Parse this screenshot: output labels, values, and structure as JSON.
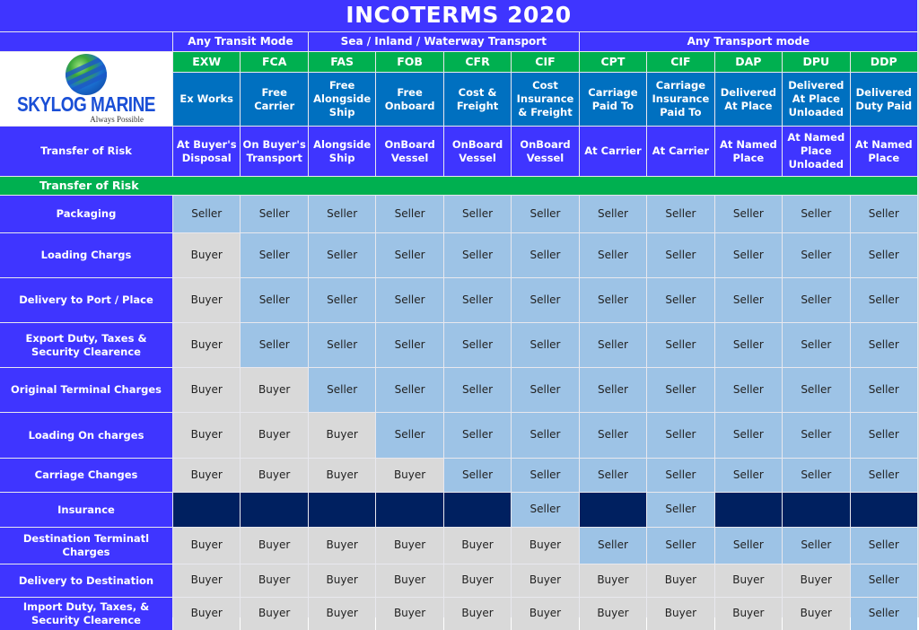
{
  "title": "INCOTERMS 2020",
  "logo": {
    "name": "SKYLOG MARINE",
    "tagline": "Always Possible",
    "icon": "globe-icon"
  },
  "groups": [
    {
      "label": "Any Transit Mode",
      "span": 2
    },
    {
      "label": "Sea / Inland / Waterway Transport",
      "span": 4
    },
    {
      "label": "Any Transport mode",
      "span": 5
    }
  ],
  "terms": [
    {
      "code": "EXW",
      "name": "Ex Works",
      "risk": "At Buyer's Disposal"
    },
    {
      "code": "FCA",
      "name": "Free Carrier",
      "risk": "On Buyer's Transport"
    },
    {
      "code": "FAS",
      "name": "Free Alongside Ship",
      "risk": "Alongside Ship"
    },
    {
      "code": "FOB",
      "name": "Free Onboard",
      "risk": "OnBoard Vessel"
    },
    {
      "code": "CFR",
      "name": "Cost & Freight",
      "risk": "OnBoard Vessel"
    },
    {
      "code": "CIF",
      "name": "Cost Insurance & Freight",
      "risk": "OnBoard Vessel"
    },
    {
      "code": "CPT",
      "name": "Carriage Paid To",
      "risk": "At Carrier"
    },
    {
      "code": "CIF",
      "name": "Carriage Insurance Paid To",
      "risk": "At Carrier"
    },
    {
      "code": "DAP",
      "name": "Delivered At Place",
      "risk": "At Named Place"
    },
    {
      "code": "DPU",
      "name": "Delivered At Place Unloaded",
      "risk": "At Named Place Unloaded"
    },
    {
      "code": "DDP",
      "name": "Delivered Duty Paid",
      "risk": "At Named Place"
    }
  ],
  "risk_row_label": "Transfer of Risk",
  "band_label": "Transfer of Risk",
  "colors": {
    "header_purple": "#3f35ff",
    "green": "#00b050",
    "name_blue": "#0070c0",
    "seller": "#9dc3e6",
    "buyer": "#d9d9d9",
    "not_applicable": "#002060"
  },
  "rows": [
    {
      "label": "Packaging",
      "values": [
        "Seller",
        "Seller",
        "Seller",
        "Seller",
        "Seller",
        "Seller",
        "Seller",
        "Seller",
        "Seller",
        "Seller",
        "Seller"
      ]
    },
    {
      "label": "Loading Chargs",
      "values": [
        "Buyer",
        "Seller",
        "Seller",
        "Seller",
        "Seller",
        "Seller",
        "Seller",
        "Seller",
        "Seller",
        "Seller",
        "Seller"
      ]
    },
    {
      "label": "Delivery to Port / Place",
      "values": [
        "Buyer",
        "Seller",
        "Seller",
        "Seller",
        "Seller",
        "Seller",
        "Seller",
        "Seller",
        "Seller",
        "Seller",
        "Seller"
      ]
    },
    {
      "label": "Export Duty, Taxes & Security Clearence",
      "values": [
        "Buyer",
        "Seller",
        "Seller",
        "Seller",
        "Seller",
        "Seller",
        "Seller",
        "Seller",
        "Seller",
        "Seller",
        "Seller"
      ]
    },
    {
      "label": "Original Terminal Charges",
      "values": [
        "Buyer",
        "Buyer",
        "Seller",
        "Seller",
        "Seller",
        "Seller",
        "Seller",
        "Seller",
        "Seller",
        "Seller",
        "Seller"
      ]
    },
    {
      "label": "Loading On charges",
      "values": [
        "Buyer",
        "Buyer",
        "Buyer",
        "Seller",
        "Seller",
        "Seller",
        "Seller",
        "Seller",
        "Seller",
        "Seller",
        "Seller"
      ]
    },
    {
      "label": "Carriage Changes",
      "values": [
        "Buyer",
        "Buyer",
        "Buyer",
        "Buyer",
        "Seller",
        "Seller",
        "Seller",
        "Seller",
        "Seller",
        "Seller",
        "Seller"
      ]
    },
    {
      "label": "Insurance",
      "values": [
        "",
        "",
        "",
        "",
        "",
        "Seller",
        "",
        "Seller",
        "",
        "",
        ""
      ]
    },
    {
      "label": "Destination Terminatl Charges",
      "values": [
        "Buyer",
        "Buyer",
        "Buyer",
        "Buyer",
        "Buyer",
        "Buyer",
        "Seller",
        "Seller",
        "Seller",
        "Seller",
        "Seller"
      ]
    },
    {
      "label": "Delivery to Destination",
      "values": [
        "Buyer",
        "Buyer",
        "Buyer",
        "Buyer",
        "Buyer",
        "Buyer",
        "Buyer",
        "Buyer",
        "Buyer",
        "Buyer",
        "Seller"
      ]
    },
    {
      "label": "Import Duty, Taxes, & Security Clearence",
      "values": [
        "Buyer",
        "Buyer",
        "Buyer",
        "Buyer",
        "Buyer",
        "Buyer",
        "Buyer",
        "Buyer",
        "Buyer",
        "Buyer",
        "Seller"
      ]
    }
  ]
}
